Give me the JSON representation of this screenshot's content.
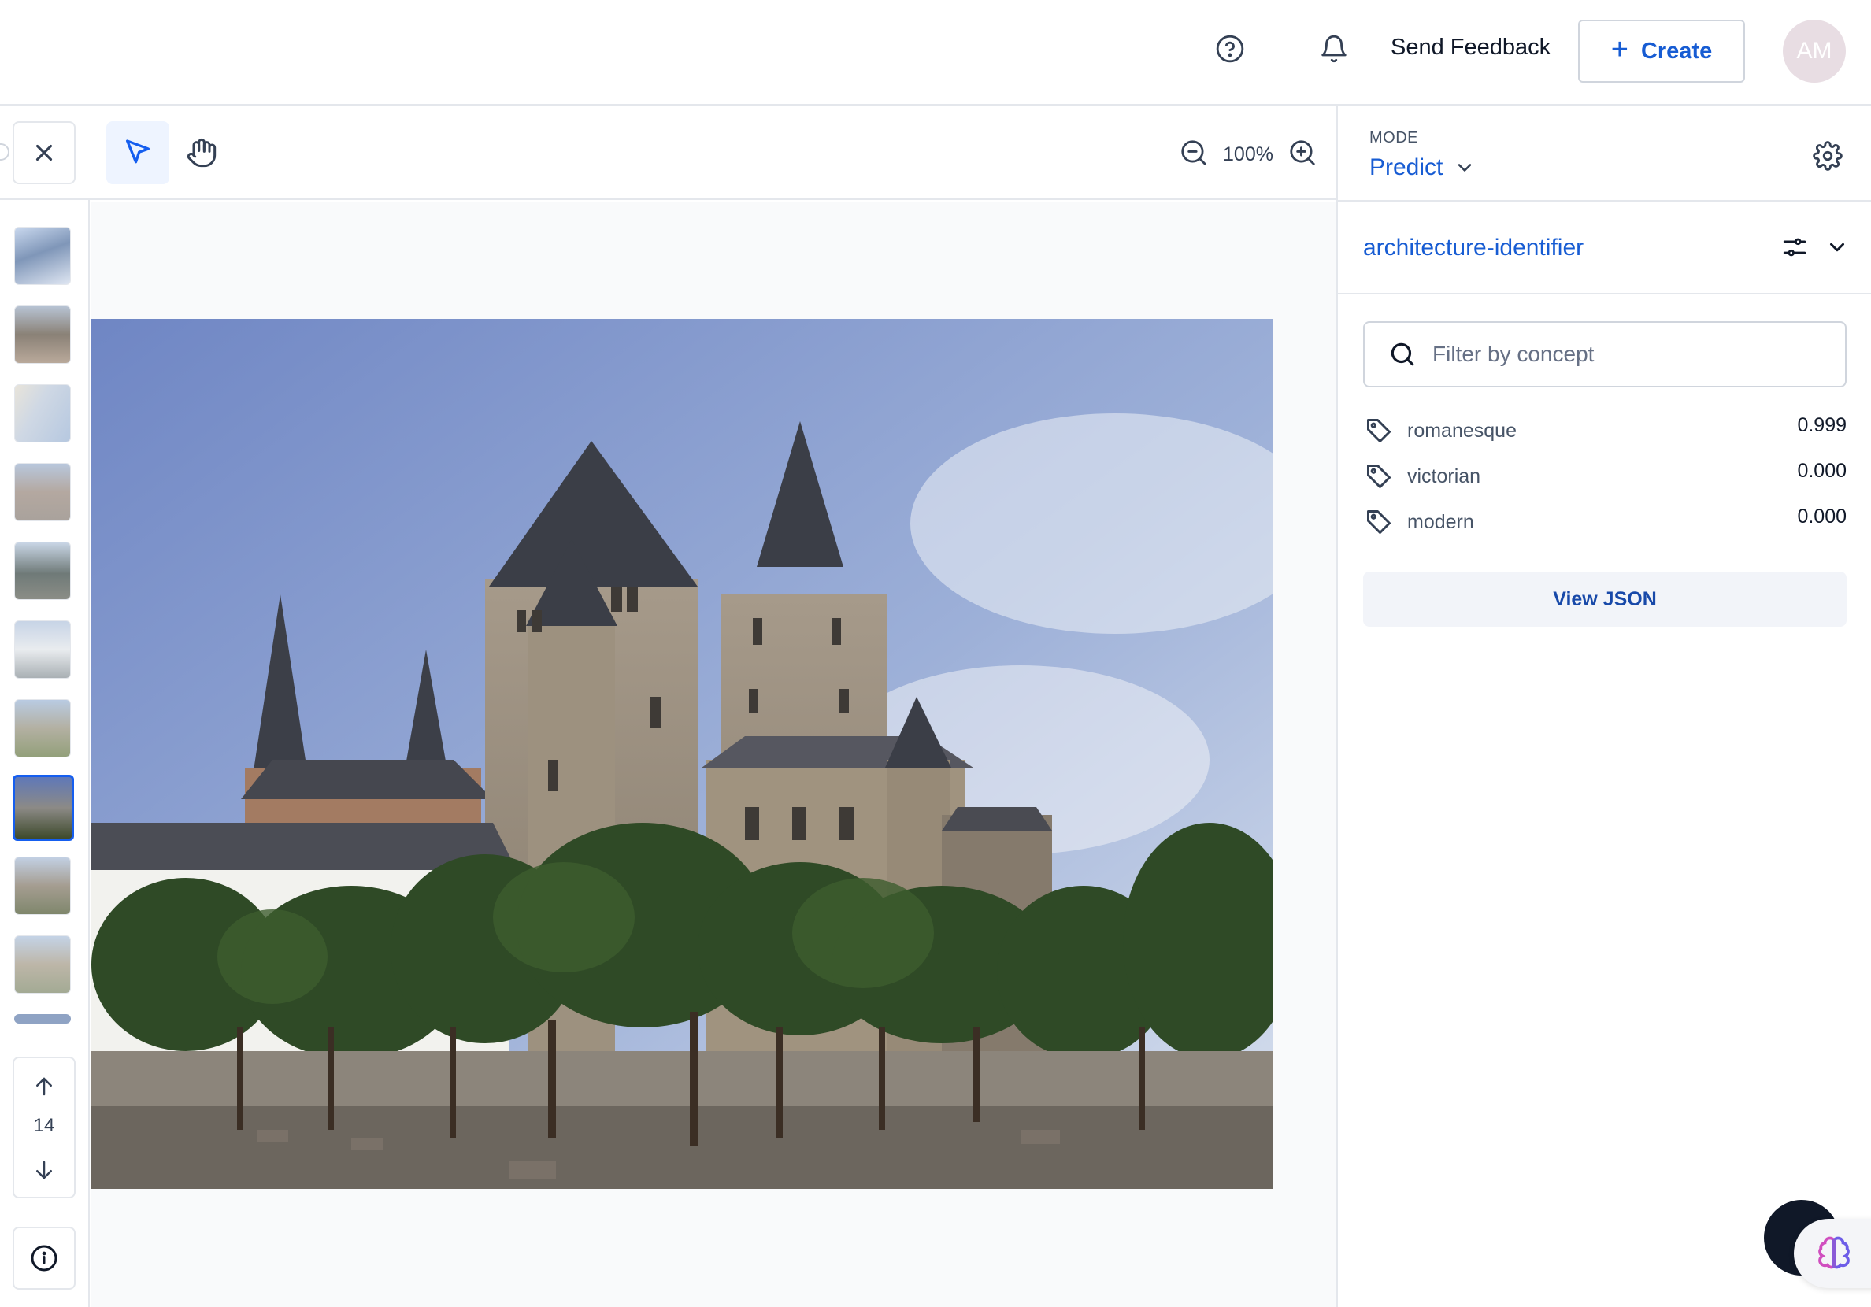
{
  "header": {
    "help_icon": "help-circle-icon",
    "notifications_icon": "bell-icon",
    "send_feedback": "Send Feedback",
    "create_label": "Create",
    "avatar_initials": "AM"
  },
  "toolbar": {
    "close_icon": "close-icon",
    "select_tool_icon": "pointer-icon",
    "pan_tool_icon": "hand-icon",
    "zoom_level": "100%"
  },
  "thumbnails": {
    "count_visible": 10,
    "selected_index": 7,
    "current_page": "14"
  },
  "panel": {
    "mode_label": "MODE",
    "mode_value": "Predict",
    "model_name": "architecture-identifier",
    "filter_placeholder": "Filter by concept",
    "concepts": [
      {
        "name": "romanesque",
        "value": "0.999"
      },
      {
        "name": "victorian",
        "value": "0.000"
      },
      {
        "name": "modern",
        "value": "0.000"
      }
    ],
    "view_json": "View JSON"
  },
  "colors": {
    "accent": "#175cd3",
    "selected_border": "#155eef",
    "border": "#e4e7ec"
  }
}
